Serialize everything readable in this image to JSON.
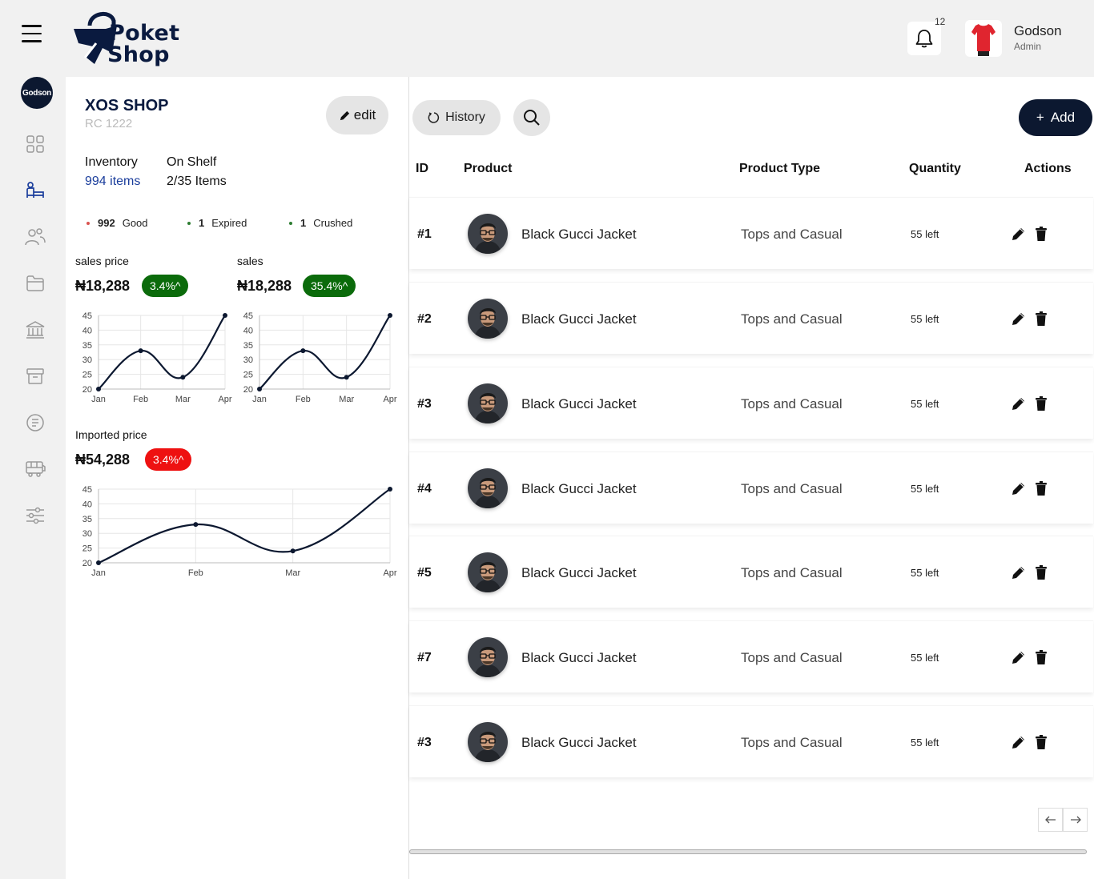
{
  "header": {
    "logo_line1": "Poket",
    "logo_line2": "Shop",
    "notification_count": "12",
    "user_name": "Godson",
    "user_role": "Admin"
  },
  "sidebar": {
    "avatar_text": "Godson",
    "items": [
      "grid-icon",
      "bed-icon",
      "users-icon",
      "folder-icon",
      "bank-icon",
      "archive-icon",
      "receipt-icon",
      "bus-icon",
      "sliders-icon"
    ]
  },
  "shop": {
    "name": "XOS SHOP",
    "rc": "RC 1222",
    "edit_label": "edit",
    "inventory_label": "Inventory",
    "inventory_value": "994 items",
    "shelf_label": "On Shelf",
    "shelf_value": "2/35 Items",
    "stats": [
      {
        "count": "992",
        "label": "Good",
        "color": "#d9534f"
      },
      {
        "count": "1",
        "label": "Expired",
        "color": "#2e7d32"
      },
      {
        "count": "1",
        "label": "Crushed",
        "color": "#2e7d32"
      }
    ]
  },
  "metrics": [
    {
      "label": "sales price",
      "value": "₦18,288",
      "badge": "3.4%^",
      "badge_color": "#0b6b0b"
    },
    {
      "label": "sales",
      "value": "₦18,288",
      "badge": "35.4%^",
      "badge_color": "#0b6b0b"
    },
    {
      "label": "Imported price",
      "value": "₦54,288",
      "badge": "3.4%^",
      "badge_color": "#ee1111"
    }
  ],
  "chart_data": [
    {
      "type": "line",
      "x": [
        "Jan",
        "Feb",
        "Mar",
        "Apr"
      ],
      "y": [
        20,
        33,
        24,
        45
      ],
      "ylim": [
        20,
        45
      ],
      "yticks": [
        20,
        25,
        30,
        35,
        40,
        45
      ],
      "grid": true
    },
    {
      "type": "line",
      "x": [
        "Jan",
        "Feb",
        "Mar",
        "Apr"
      ],
      "y": [
        20,
        33,
        24,
        45
      ],
      "ylim": [
        20,
        45
      ],
      "yticks": [
        20,
        25,
        30,
        35,
        40,
        45
      ],
      "grid": true
    },
    {
      "type": "line",
      "x": [
        "Jan",
        "Feb",
        "Mar",
        "Apr"
      ],
      "y": [
        20,
        33,
        24,
        45
      ],
      "ylim": [
        20,
        45
      ],
      "yticks": [
        20,
        25,
        30,
        35,
        40,
        45
      ],
      "grid": true
    }
  ],
  "toolbar": {
    "history_label": "History",
    "add_label": "Add"
  },
  "table": {
    "headers": [
      "ID",
      "Product",
      "Product Type",
      "Quantity",
      "Actions"
    ],
    "rows": [
      {
        "id": "#1",
        "product": "Black Gucci Jacket",
        "type": "Tops and Casual",
        "qty": "55 left"
      },
      {
        "id": "#2",
        "product": "Black Gucci Jacket",
        "type": "Tops and Casual",
        "qty": "55 left"
      },
      {
        "id": "#3",
        "product": "Black Gucci Jacket",
        "type": "Tops and Casual",
        "qty": "55 left"
      },
      {
        "id": "#4",
        "product": "Black Gucci Jacket",
        "type": "Tops and Casual",
        "qty": "55 left"
      },
      {
        "id": "#5",
        "product": "Black Gucci Jacket",
        "type": "Tops and Casual",
        "qty": "55 left"
      },
      {
        "id": "#7",
        "product": "Black Gucci Jacket",
        "type": "Tops and Casual",
        "qty": "55 left"
      },
      {
        "id": "#3",
        "product": "Black Gucci Jacket",
        "type": "Tops and Casual",
        "qty": "55 left"
      }
    ]
  },
  "colors": {
    "brand_navy": "#0c1830",
    "link_blue": "#1b3e9c"
  }
}
